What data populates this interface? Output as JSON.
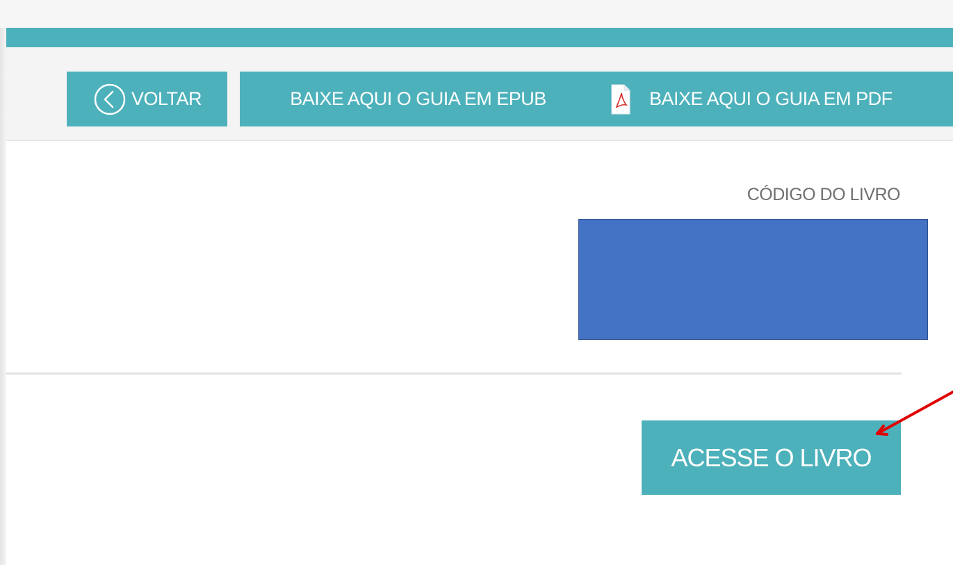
{
  "toolbar": {
    "back_label": "VOLTAR",
    "epub_label": "BAIXE AQUI O GUIA EM EPUB",
    "pdf_label": "BAIXE AQUI O GUIA EM PDF",
    "back_icon": "chevron-left-circle-icon",
    "pdf_icon": "pdf-file-icon"
  },
  "form": {
    "code_label": "CÓDIGO DO LIVRO",
    "access_label": "ACESSE O LIVRO"
  },
  "colors": {
    "accent": "#4db1bb",
    "code_box": "#4472c4",
    "annotation_arrow": "#e00000"
  }
}
